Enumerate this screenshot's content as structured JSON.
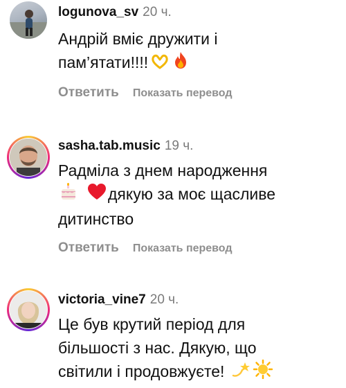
{
  "comments": [
    {
      "username": "logunova_sv",
      "time": "20 ч.",
      "text_line1": "Андрій вміє дружити і",
      "text_line2": "пам’ятати!!!!",
      "emojis": [
        "heart-hands-icon",
        "fire-icon"
      ],
      "reply_label": "Ответить",
      "translate_label": "Показать перевод"
    },
    {
      "username": "sasha.tab.music",
      "time": "19 ч.",
      "text_line1": "Радміла з днем народження",
      "text_line2": "дякую за моє щасливе",
      "text_line3": "дитинство",
      "emojis": [
        "birthday-cake-icon",
        "red-heart-icon"
      ],
      "reply_label": "Ответить",
      "translate_label": "Показать перевод"
    },
    {
      "username": "victoria_vine7",
      "time": "20 ч.",
      "text_line1": "Це був крутий період для",
      "text_line2": "більшості з нас. Дякую, що",
      "text_line3": "світили і продовжуєте!",
      "emojis": [
        "dizzy-star-icon",
        "sun-icon"
      ]
    }
  ],
  "colors": {
    "text": "#111111",
    "muted": "#8e8e8e",
    "story_ring": [
      "#f9ce34",
      "#ee2a7b",
      "#6228d7"
    ]
  }
}
